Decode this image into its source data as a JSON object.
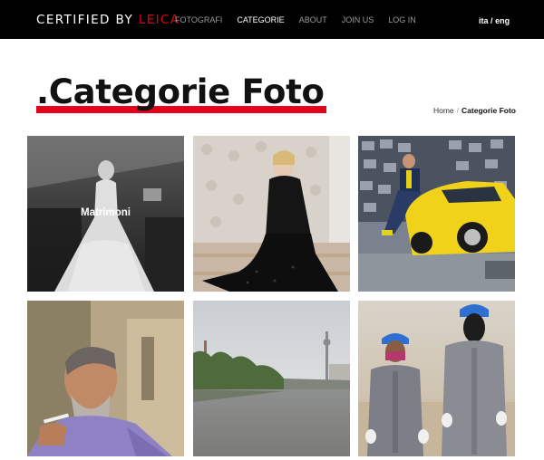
{
  "header": {
    "logo_main": "CERTIFIED BY ",
    "logo_accent": "LEICA",
    "nav": [
      {
        "label": "FOTOGRAFI",
        "active": false
      },
      {
        "label": "CATEGORIE",
        "active": true
      },
      {
        "label": "ABOUT",
        "active": false
      },
      {
        "label": "JOIN US",
        "active": false
      },
      {
        "label": "LOG IN",
        "active": false
      }
    ],
    "lang_ita": "ita",
    "lang_sep": "/",
    "lang_eng": "eng"
  },
  "page": {
    "title": ".Categorie Foto",
    "breadcrumb_home": "Home",
    "breadcrumb_sep": "/",
    "breadcrumb_current": "Categorie Foto"
  },
  "gallery": {
    "tiles": [
      {
        "label": "Matrimoni"
      },
      {
        "label": ""
      },
      {
        "label": ""
      },
      {
        "label": ""
      },
      {
        "label": ""
      },
      {
        "label": ""
      }
    ]
  },
  "colors": {
    "brand_red": "#e2001a",
    "header_bg": "#000000"
  }
}
